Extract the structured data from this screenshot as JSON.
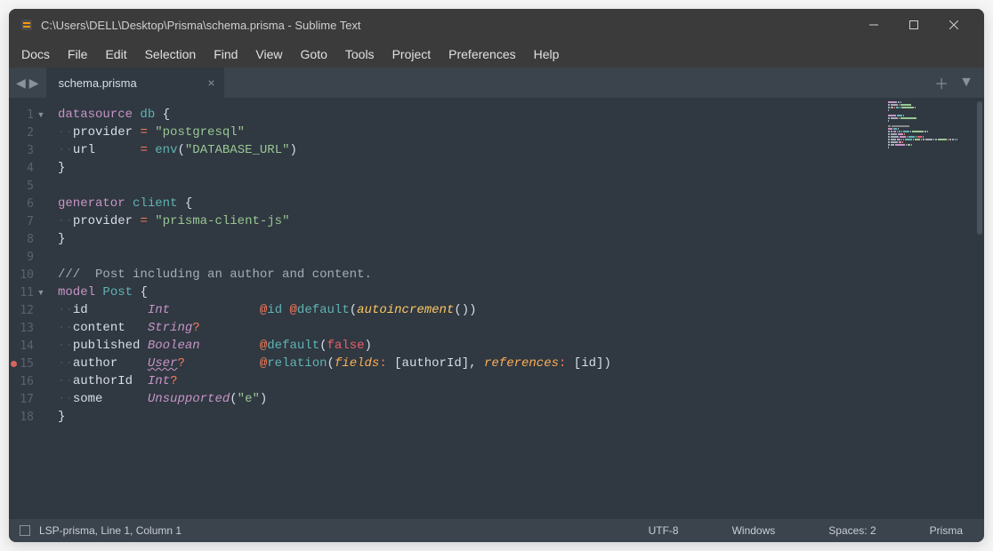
{
  "window": {
    "title": "C:\\Users\\DELL\\Desktop\\Prisma\\schema.prisma - Sublime Text"
  },
  "menu": {
    "items": [
      "Docs",
      "File",
      "Edit",
      "Selection",
      "Find",
      "View",
      "Goto",
      "Tools",
      "Project",
      "Preferences",
      "Help"
    ]
  },
  "tabs": {
    "active_name": "schema.prisma"
  },
  "lines": [
    {
      "no": "1",
      "fold": true,
      "dot": false,
      "seg": [
        {
          "t": "datasource",
          "c": "c-kw"
        },
        {
          "t": " ",
          "c": ""
        },
        {
          "t": "db",
          "c": "c-func"
        },
        {
          "t": " ",
          "c": ""
        },
        {
          "t": "{",
          "c": "c-par"
        }
      ]
    },
    {
      "no": "2",
      "fold": false,
      "dot": false,
      "seg": [
        {
          "t": "··",
          "c": "c-ws"
        },
        {
          "t": "provider",
          "c": "c-prop"
        },
        {
          "t": " ",
          "c": ""
        },
        {
          "t": "=",
          "c": "c-op"
        },
        {
          "t": " ",
          "c": ""
        },
        {
          "t": "\"postgresql\"",
          "c": "c-str"
        }
      ]
    },
    {
      "no": "3",
      "fold": false,
      "dot": false,
      "seg": [
        {
          "t": "··",
          "c": "c-ws"
        },
        {
          "t": "url",
          "c": "c-prop"
        },
        {
          "t": "      ",
          "c": ""
        },
        {
          "t": "=",
          "c": "c-op"
        },
        {
          "t": " ",
          "c": ""
        },
        {
          "t": "env",
          "c": "c-func"
        },
        {
          "t": "(",
          "c": "c-par"
        },
        {
          "t": "\"DATABASE_URL\"",
          "c": "c-str"
        },
        {
          "t": ")",
          "c": "c-par"
        }
      ]
    },
    {
      "no": "4",
      "fold": false,
      "dot": false,
      "seg": [
        {
          "t": "}",
          "c": "c-par"
        }
      ]
    },
    {
      "no": "5",
      "fold": false,
      "dot": false,
      "seg": []
    },
    {
      "no": "6",
      "fold": false,
      "dot": false,
      "seg": [
        {
          "t": "generator",
          "c": "c-kw"
        },
        {
          "t": " ",
          "c": ""
        },
        {
          "t": "client",
          "c": "c-func"
        },
        {
          "t": " ",
          "c": ""
        },
        {
          "t": "{",
          "c": "c-par"
        }
      ]
    },
    {
      "no": "7",
      "fold": false,
      "dot": false,
      "seg": [
        {
          "t": "··",
          "c": "c-ws"
        },
        {
          "t": "provider",
          "c": "c-prop"
        },
        {
          "t": " ",
          "c": ""
        },
        {
          "t": "=",
          "c": "c-op"
        },
        {
          "t": " ",
          "c": ""
        },
        {
          "t": "\"prisma-client-js\"",
          "c": "c-str"
        }
      ]
    },
    {
      "no": "8",
      "fold": false,
      "dot": false,
      "seg": [
        {
          "t": "}",
          "c": "c-par"
        }
      ]
    },
    {
      "no": "9",
      "fold": false,
      "dot": false,
      "seg": []
    },
    {
      "no": "10",
      "fold": false,
      "dot": false,
      "seg": [
        {
          "t": "///",
          "c": "c-cmt"
        },
        {
          "t": "  Post including an author and content.",
          "c": "c-cmt"
        }
      ]
    },
    {
      "no": "11",
      "fold": true,
      "dot": false,
      "seg": [
        {
          "t": "model",
          "c": "c-kw"
        },
        {
          "t": " ",
          "c": ""
        },
        {
          "t": "Post",
          "c": "c-func"
        },
        {
          "t": " ",
          "c": ""
        },
        {
          "t": "{",
          "c": "c-par"
        }
      ]
    },
    {
      "no": "12",
      "fold": false,
      "dot": false,
      "seg": [
        {
          "t": "··",
          "c": "c-ws"
        },
        {
          "t": "id",
          "c": "c-prop"
        },
        {
          "t": "        ",
          "c": ""
        },
        {
          "t": "Int",
          "c": "c-type"
        },
        {
          "t": "            ",
          "c": ""
        },
        {
          "t": "@",
          "c": "c-op"
        },
        {
          "t": "id",
          "c": "c-attr"
        },
        {
          "t": " ",
          "c": ""
        },
        {
          "t": "@",
          "c": "c-op"
        },
        {
          "t": "default",
          "c": "c-attr"
        },
        {
          "t": "(",
          "c": "c-par"
        },
        {
          "t": "autoincrement",
          "c": "c-fnname"
        },
        {
          "t": "()",
          "c": "c-par"
        },
        {
          "t": ")",
          "c": "c-par"
        }
      ]
    },
    {
      "no": "13",
      "fold": false,
      "dot": false,
      "seg": [
        {
          "t": "··",
          "c": "c-ws"
        },
        {
          "t": "content",
          "c": "c-prop"
        },
        {
          "t": "   ",
          "c": ""
        },
        {
          "t": "String",
          "c": "c-type"
        },
        {
          "t": "?",
          "c": "c-op"
        }
      ]
    },
    {
      "no": "14",
      "fold": false,
      "dot": false,
      "seg": [
        {
          "t": "··",
          "c": "c-ws"
        },
        {
          "t": "published",
          "c": "c-prop"
        },
        {
          "t": " ",
          "c": ""
        },
        {
          "t": "Boolean",
          "c": "c-type"
        },
        {
          "t": "        ",
          "c": ""
        },
        {
          "t": "@",
          "c": "c-op"
        },
        {
          "t": "default",
          "c": "c-attr"
        },
        {
          "t": "(",
          "c": "c-par"
        },
        {
          "t": "false",
          "c": "c-const"
        },
        {
          "t": ")",
          "c": "c-par"
        }
      ]
    },
    {
      "no": "15",
      "fold": false,
      "dot": true,
      "seg": [
        {
          "t": "··",
          "c": "c-ws"
        },
        {
          "t": "author",
          "c": "c-prop"
        },
        {
          "t": "    ",
          "c": ""
        },
        {
          "t": "User",
          "c": "c-typeun"
        },
        {
          "t": "?",
          "c": "c-op"
        },
        {
          "t": "          ",
          "c": ""
        },
        {
          "t": "@",
          "c": "c-op"
        },
        {
          "t": "relation",
          "c": "c-attr"
        },
        {
          "t": "(",
          "c": "c-par"
        },
        {
          "t": "fields",
          "c": "c-argn"
        },
        {
          "t": ":",
          "c": "c-op"
        },
        {
          "t": " [",
          "c": "c-par"
        },
        {
          "t": "authorId",
          "c": "c-prop"
        },
        {
          "t": "]",
          "c": "c-par"
        },
        {
          "t": ", ",
          "c": ""
        },
        {
          "t": "references",
          "c": "c-argn"
        },
        {
          "t": ":",
          "c": "c-op"
        },
        {
          "t": " [",
          "c": "c-par"
        },
        {
          "t": "id",
          "c": "c-prop"
        },
        {
          "t": "]",
          "c": "c-par"
        },
        {
          "t": ")",
          "c": "c-par"
        }
      ]
    },
    {
      "no": "16",
      "fold": false,
      "dot": false,
      "seg": [
        {
          "t": "··",
          "c": "c-ws"
        },
        {
          "t": "authorId",
          "c": "c-prop"
        },
        {
          "t": "  ",
          "c": ""
        },
        {
          "t": "Int",
          "c": "c-type"
        },
        {
          "t": "?",
          "c": "c-op"
        }
      ]
    },
    {
      "no": "17",
      "fold": false,
      "dot": false,
      "seg": [
        {
          "t": "··",
          "c": "c-ws"
        },
        {
          "t": "some",
          "c": "c-prop"
        },
        {
          "t": "      ",
          "c": ""
        },
        {
          "t": "Unsupported",
          "c": "c-type"
        },
        {
          "t": "(",
          "c": "c-par"
        },
        {
          "t": "\"e\"",
          "c": "c-str"
        },
        {
          "t": ")",
          "c": "c-par"
        }
      ]
    },
    {
      "no": "18",
      "fold": false,
      "dot": false,
      "seg": [
        {
          "t": "}",
          "c": "c-par"
        }
      ]
    }
  ],
  "status": {
    "left": "LSP-prisma, Line 1, Column 1",
    "encoding": "UTF-8",
    "line_ending": "Windows",
    "tab_size": "Spaces: 2",
    "syntax": "Prisma"
  }
}
